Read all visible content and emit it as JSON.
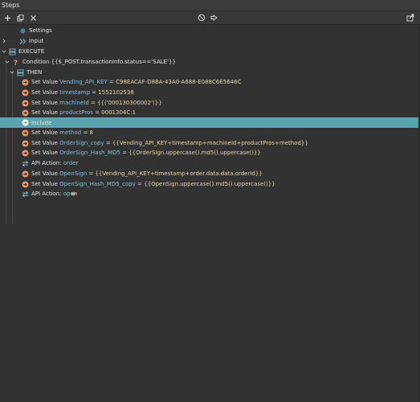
{
  "panel": {
    "title": "Steps"
  },
  "toolbar": {
    "add": "add-icon",
    "copy": "copy-icon",
    "delete": "close-icon",
    "disable": "disable-icon",
    "goto": "goto-icon",
    "export": "export-icon"
  },
  "tree": {
    "settings": "Settings",
    "input": "Input",
    "execute": "EXECUTE",
    "condition": "Condition {{$_POST.transactionInfo.status=='SALE'}}",
    "then": "THEN",
    "steps": [
      {
        "prefix": "Set Value ",
        "name": "Vending_API_KEY",
        "value": " = C98EACAF-D8BA-43A0-A688-E088C6E5646C"
      },
      {
        "prefix": "Set Value ",
        "name": "timestamp",
        "value": " = 1552102538"
      },
      {
        "prefix": "Set Value ",
        "name": "machineId",
        "value": " = {{('000130300002')}}"
      },
      {
        "prefix": "Set Value ",
        "name": "productPros",
        "value": " = 0001304C:1"
      },
      {
        "prefix": "Include",
        "name": "",
        "value": ""
      },
      {
        "prefix": "Set Value ",
        "name": "method",
        "value": " = 8"
      },
      {
        "prefix": "Set Value ",
        "name": "OrderSign_copy",
        "value": " = {{Vending_API_KEY+timestamp+machineId+productPros+method}}"
      },
      {
        "prefix": "Set Value ",
        "name": "OrderSign_Hash_MD5",
        "value": " = {{OrderSign.uppercase().md5().uppercase()}}"
      },
      {
        "prefix": "API Action: ",
        "name": "order",
        "value": ""
      },
      {
        "prefix": "Set Value ",
        "name": "OpenSign",
        "value": " = {{Vending_API_KEY+timestamp+order.data.data.orderId}}"
      },
      {
        "prefix": "Set Value ",
        "name": "OpenSign_Hash_MD5_copy",
        "value": " = {{OpenSign.uppercase().md5().uppercase()}}"
      },
      {
        "prefix": "API Action: ",
        "name": "open",
        "value": ""
      }
    ]
  },
  "colors": {
    "selected_row": "#5aa4b0",
    "set_value_icon": "#e8956a",
    "api_icon": "#7ec1d9",
    "link_icon": "#e8956a"
  }
}
